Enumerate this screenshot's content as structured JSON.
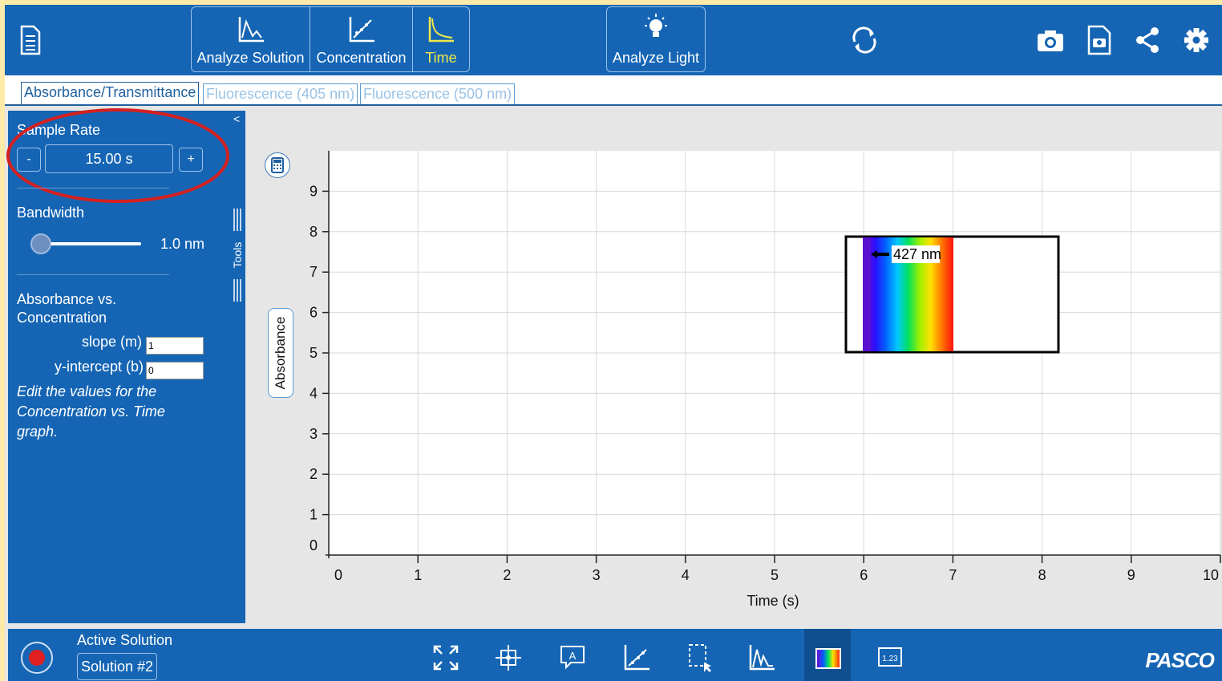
{
  "toolbar": {
    "modes": [
      {
        "label": "Analyze Solution",
        "icon": "analyze-solution-icon",
        "active": false
      },
      {
        "label": "Concentration",
        "icon": "concentration-icon",
        "active": false
      },
      {
        "label": "Time",
        "icon": "time-icon",
        "active": true
      }
    ],
    "analyze_light": {
      "label": "Analyze Light",
      "icon": "lightbulb-icon"
    },
    "icons": [
      "document-menu-icon",
      "sync-icon",
      "camera-icon",
      "snapshot-file-icon",
      "share-icon",
      "gear-icon"
    ]
  },
  "tabs": [
    {
      "label": "Absorbance/Transmittance",
      "active": true
    },
    {
      "label": "Fluorescence (405 nm)",
      "active": false
    },
    {
      "label": "Fluorescence (500 nm)",
      "active": false
    }
  ],
  "panel": {
    "collapse_glyph": "<",
    "sample_rate": {
      "label": "Sample Rate",
      "value": "15.00 s",
      "minus": "-",
      "plus": "+"
    },
    "bandwidth": {
      "label": "Bandwidth",
      "value": "1.0 nm",
      "slider_fraction": 0.0
    },
    "tools_label": "Tools",
    "absorbance_vs_concentration": {
      "title_line1": "Absorbance vs.",
      "title_line2": "Concentration",
      "slope_label": "slope (m)",
      "slope_value": "1",
      "intercept_label": "y-intercept (b)",
      "intercept_value": "0"
    },
    "note_line1": "Edit the values for the",
    "note_line2": "Concentration vs. Time",
    "note_line3": "graph."
  },
  "chart_data": {
    "type": "line",
    "title": "",
    "xlabel": "Time (s)",
    "ylabel": "Absorbance",
    "xlim": [
      0,
      10
    ],
    "ylim": [
      0,
      10
    ],
    "x_ticks": [
      0,
      1,
      2,
      3,
      4,
      5,
      6,
      7,
      8,
      9,
      10
    ],
    "y_ticks": [
      0,
      1,
      2,
      3,
      4,
      5,
      6,
      7,
      8,
      9
    ],
    "grid": true,
    "series": [],
    "inset": {
      "type": "spectrum-selector",
      "wavelength_label": "427 nm"
    }
  },
  "bottom": {
    "active_solution_label": "Active Solution",
    "solution_name": "Solution #2",
    "tool_icons": [
      "fit-screen-icon",
      "crosshair-icon",
      "annotation-icon",
      "scale-axes-icon",
      "selection-icon",
      "peak-icon",
      "spectrum-icon",
      "digits-icon"
    ],
    "brand": "PASCO"
  }
}
